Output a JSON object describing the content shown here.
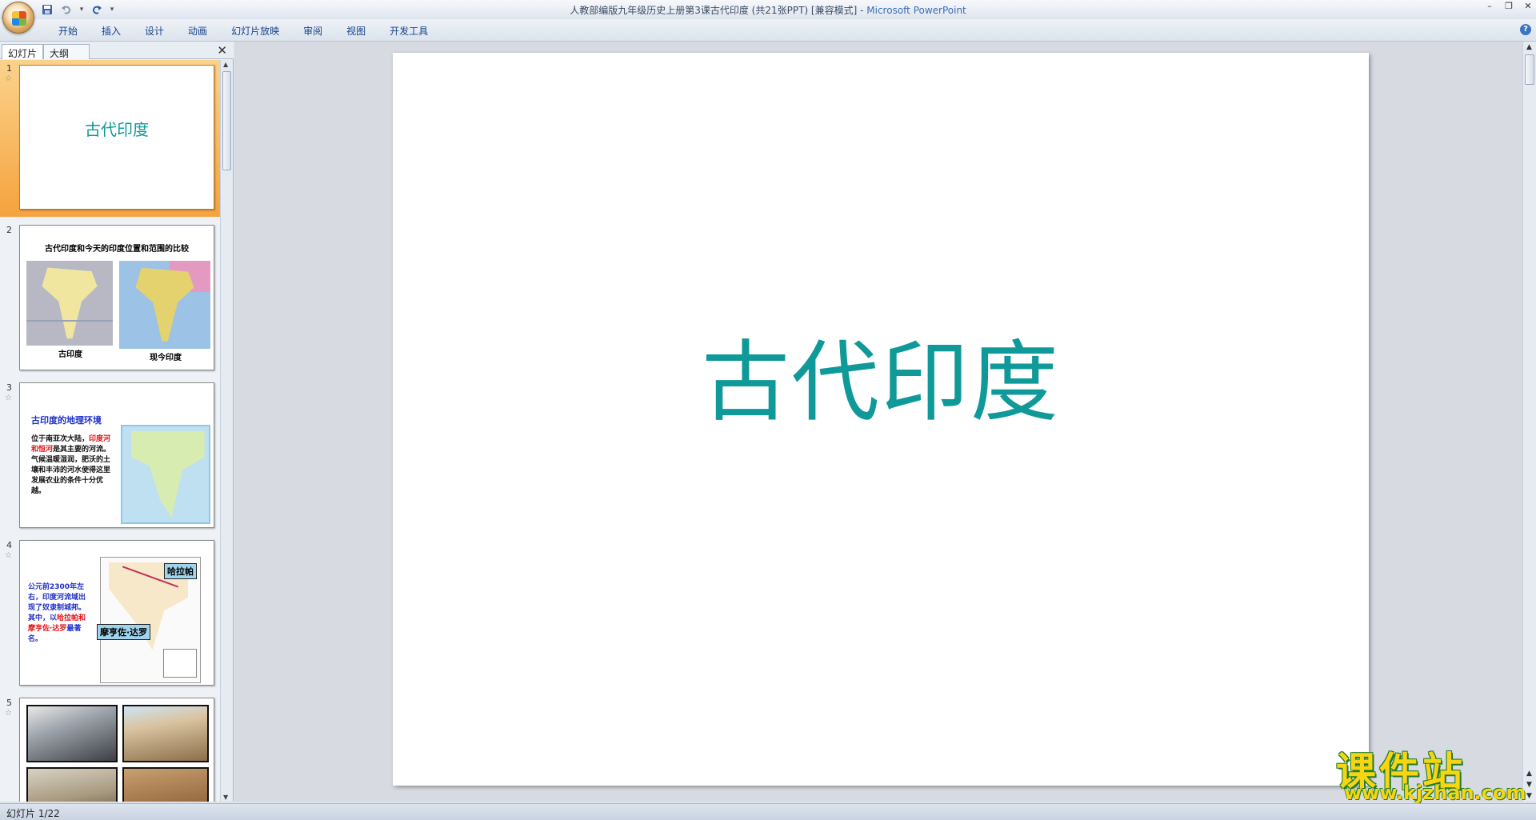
{
  "window": {
    "title": "人教部编版九年级历史上册第3课古代印度 (共21张PPT) [兼容模式] - ",
    "app_name": "Microsoft PowerPoint"
  },
  "qat": {
    "save_icon": "save-icon",
    "undo_icon": "undo-icon",
    "redo_icon": "redo-icon",
    "customize": "▾"
  },
  "ribbon": {
    "tabs": [
      "开始",
      "插入",
      "设计",
      "动画",
      "幻灯片放映",
      "审阅",
      "视图",
      "开发工具"
    ],
    "help": "?"
  },
  "pane": {
    "tab_slides": "幻灯片",
    "tab_outline": "大纲",
    "close": "✕"
  },
  "thumbnails": [
    {
      "num": "1",
      "title": "古代印度"
    },
    {
      "num": "2",
      "title": "古代印度和今天的印度位置和范围的比较",
      "cap_left": "古印度",
      "cap_right": "现今印度"
    },
    {
      "num": "3",
      "title": "古印度的地理环境",
      "text_a": "位于南亚次大陆，",
      "text_red": "印度河和恒河",
      "text_b": "是其主要的河流。气候温暖湿润，肥沃的土壤和丰沛的河水使得这里发展农业的条件十分优越。"
    },
    {
      "num": "4",
      "text_a": "公元前2300年左右，印度河流域出现了奴隶制城邦。其中，以",
      "text_red": "哈拉帕和摩亨佐·达罗",
      "text_b": "最著名。",
      "callout_1": "哈拉帕",
      "callout_2": "摩亨佐·达罗"
    },
    {
      "num": "5"
    }
  ],
  "slide": {
    "title": "古代印度"
  },
  "watermark": {
    "big": "课件站",
    "small": "www.kjzhan.com"
  },
  "status": {
    "text": "幻灯片 1/22"
  }
}
